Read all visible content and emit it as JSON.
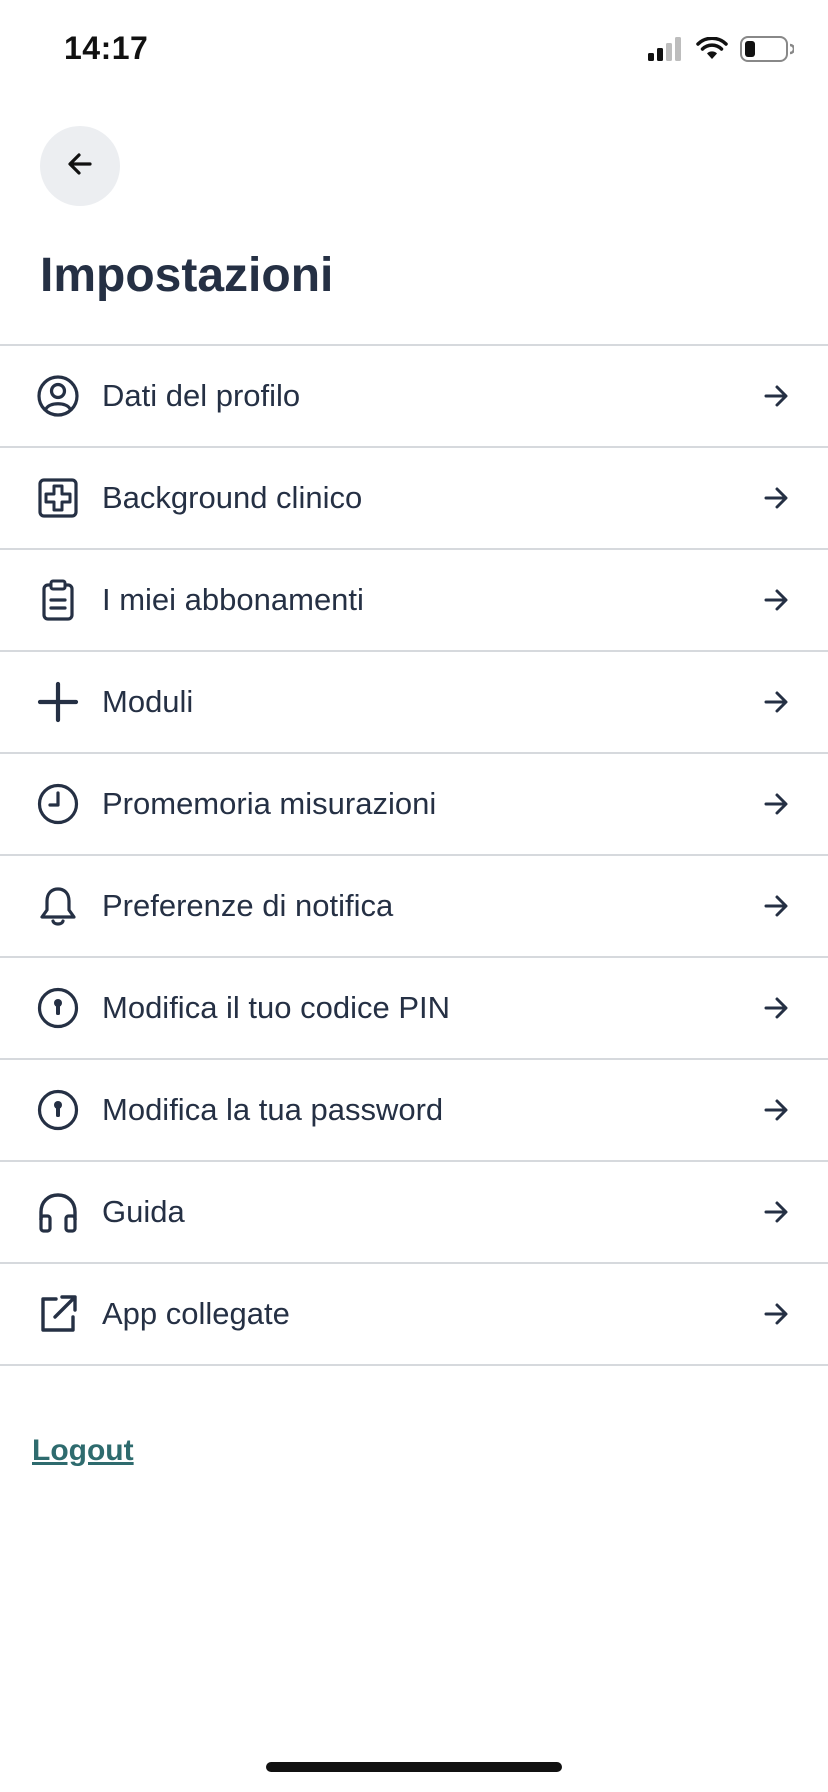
{
  "status_bar": {
    "time": "14:17"
  },
  "header": {
    "back_icon": "arrow-left-icon",
    "title": "Impostazioni"
  },
  "menu": {
    "items": [
      {
        "label": "Dati del profilo",
        "icon": "user-circle-icon"
      },
      {
        "label": "Background clinico",
        "icon": "medical-cross-icon"
      },
      {
        "label": "I miei abbonamenti",
        "icon": "clipboard-icon"
      },
      {
        "label": "Moduli",
        "icon": "plus-icon"
      },
      {
        "label": "Promemoria misurazioni",
        "icon": "clock-icon"
      },
      {
        "label": "Preferenze di notifica",
        "icon": "bell-icon"
      },
      {
        "label": "Modifica il tuo codice PIN",
        "icon": "keyhole-icon"
      },
      {
        "label": "Modifica la tua password",
        "icon": "keyhole-icon"
      },
      {
        "label": "Guida",
        "icon": "headphones-icon"
      },
      {
        "label": "App collegate",
        "icon": "external-link-icon"
      }
    ],
    "arrow_icon": "arrow-right-icon"
  },
  "footer": {
    "logout_label": "Logout"
  },
  "colors": {
    "text": "#253044",
    "divider": "#d6d9dd",
    "back_button_bg": "#eceef1",
    "logout": "#2e6b6e"
  }
}
